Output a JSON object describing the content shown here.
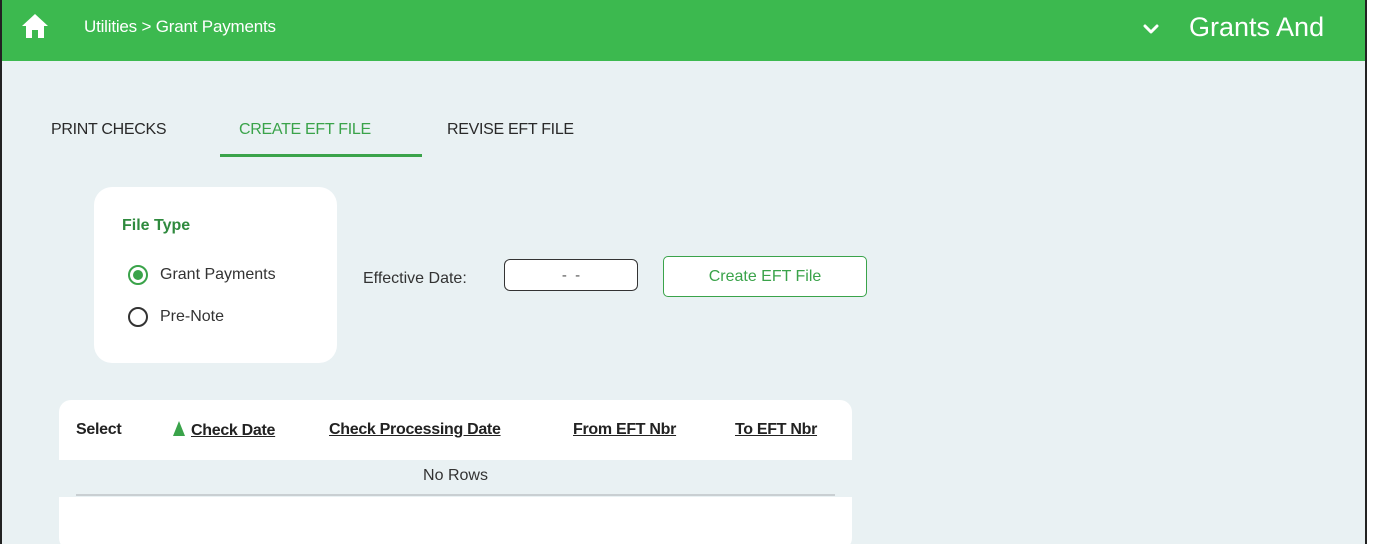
{
  "header": {
    "breadcrumb": "Utilities > Grant Payments",
    "app_title": "Grants And",
    "home_icon": "home-icon",
    "dropdown_icon": "chevron-down-icon",
    "bar_color": "#3cb94f"
  },
  "tabs": [
    {
      "label": "PRINT CHECKS",
      "active": false
    },
    {
      "label": "CREATE EFT FILE",
      "active": true
    },
    {
      "label": "REVISE EFT FILE",
      "active": false
    }
  ],
  "file_type": {
    "title": "File Type",
    "options": [
      {
        "label": "Grant Payments",
        "selected": true
      },
      {
        "label": "Pre-Note",
        "selected": false
      }
    ]
  },
  "effective_date": {
    "label": "Effective Date:",
    "value": "  -  -  "
  },
  "create_button": "Create EFT File",
  "grid": {
    "columns": [
      "Select",
      "Check Date",
      "Check Processing Date",
      "From EFT Nbr",
      "To EFT Nbr"
    ],
    "sorted_column": "Check Date",
    "empty_text": "No Rows"
  },
  "accent_color": "#3aa34a"
}
